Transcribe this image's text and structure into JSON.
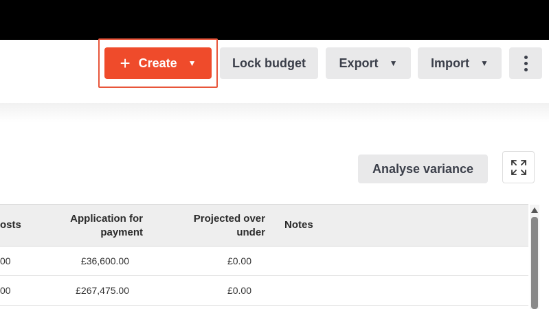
{
  "toolbar": {
    "create_label": "Create",
    "lock_budget_label": "Lock budget",
    "export_label": "Export",
    "import_label": "Import"
  },
  "actions": {
    "analyse_variance_label": "Analyse variance"
  },
  "table": {
    "headers": {
      "costs": "osts",
      "application": "Application for payment",
      "projected": "Projected over under",
      "notes": "Notes"
    },
    "rows": [
      {
        "costs": "00",
        "application": "£36,600.00",
        "projected": "£0.00",
        "notes": ""
      },
      {
        "costs": "00",
        "application": "£267,475.00",
        "projected": "£0.00",
        "notes": ""
      }
    ]
  },
  "colors": {
    "accent": "#ef4b2b",
    "highlight_outline": "#e8553a",
    "button_bg": "#e9e9ea"
  },
  "icons": [
    "plus-icon",
    "caret-down-icon",
    "kebab-menu-icon",
    "expand-icon",
    "scroll-up-arrow-icon"
  ]
}
